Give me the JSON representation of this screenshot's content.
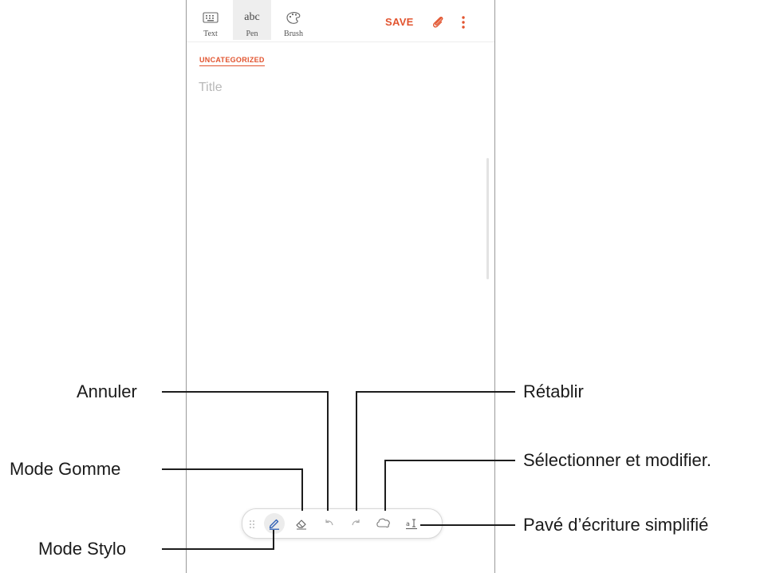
{
  "toolbar": {
    "modes": [
      {
        "label": "Text",
        "icon": "keyboard-icon"
      },
      {
        "label": "Pen",
        "icon": "abc-handwriting-icon",
        "glyph": "abc"
      },
      {
        "label": "Brush",
        "icon": "palette-icon"
      }
    ],
    "selected_mode": "Pen",
    "save_label": "SAVE",
    "attach_icon": "paperclip-icon",
    "more_icon": "more-vertical-icon"
  },
  "note": {
    "category": "UNCATEGORIZED",
    "title_placeholder": "Title"
  },
  "pen_toolbar": {
    "items": [
      "drag-handle-icon",
      "pen-mode-icon",
      "eraser-icon",
      "undo-icon",
      "redo-icon",
      "lasso-select-icon",
      "easy-writing-pad-icon"
    ]
  },
  "callouts": {
    "undo": "Annuler",
    "redo": "Rétablir",
    "eraser_mode": "Mode Gomme",
    "select_edit": "Sélectionner et modifier.",
    "pen_mode": "Mode Stylo",
    "easy_writing_pad": "Pavé d’écriture simplifié"
  },
  "colors": {
    "accent": "#e2542f",
    "pen_icon": "#2e5fb5",
    "callout_line": "#1d1d1d",
    "frame": "#9a9a9a"
  }
}
